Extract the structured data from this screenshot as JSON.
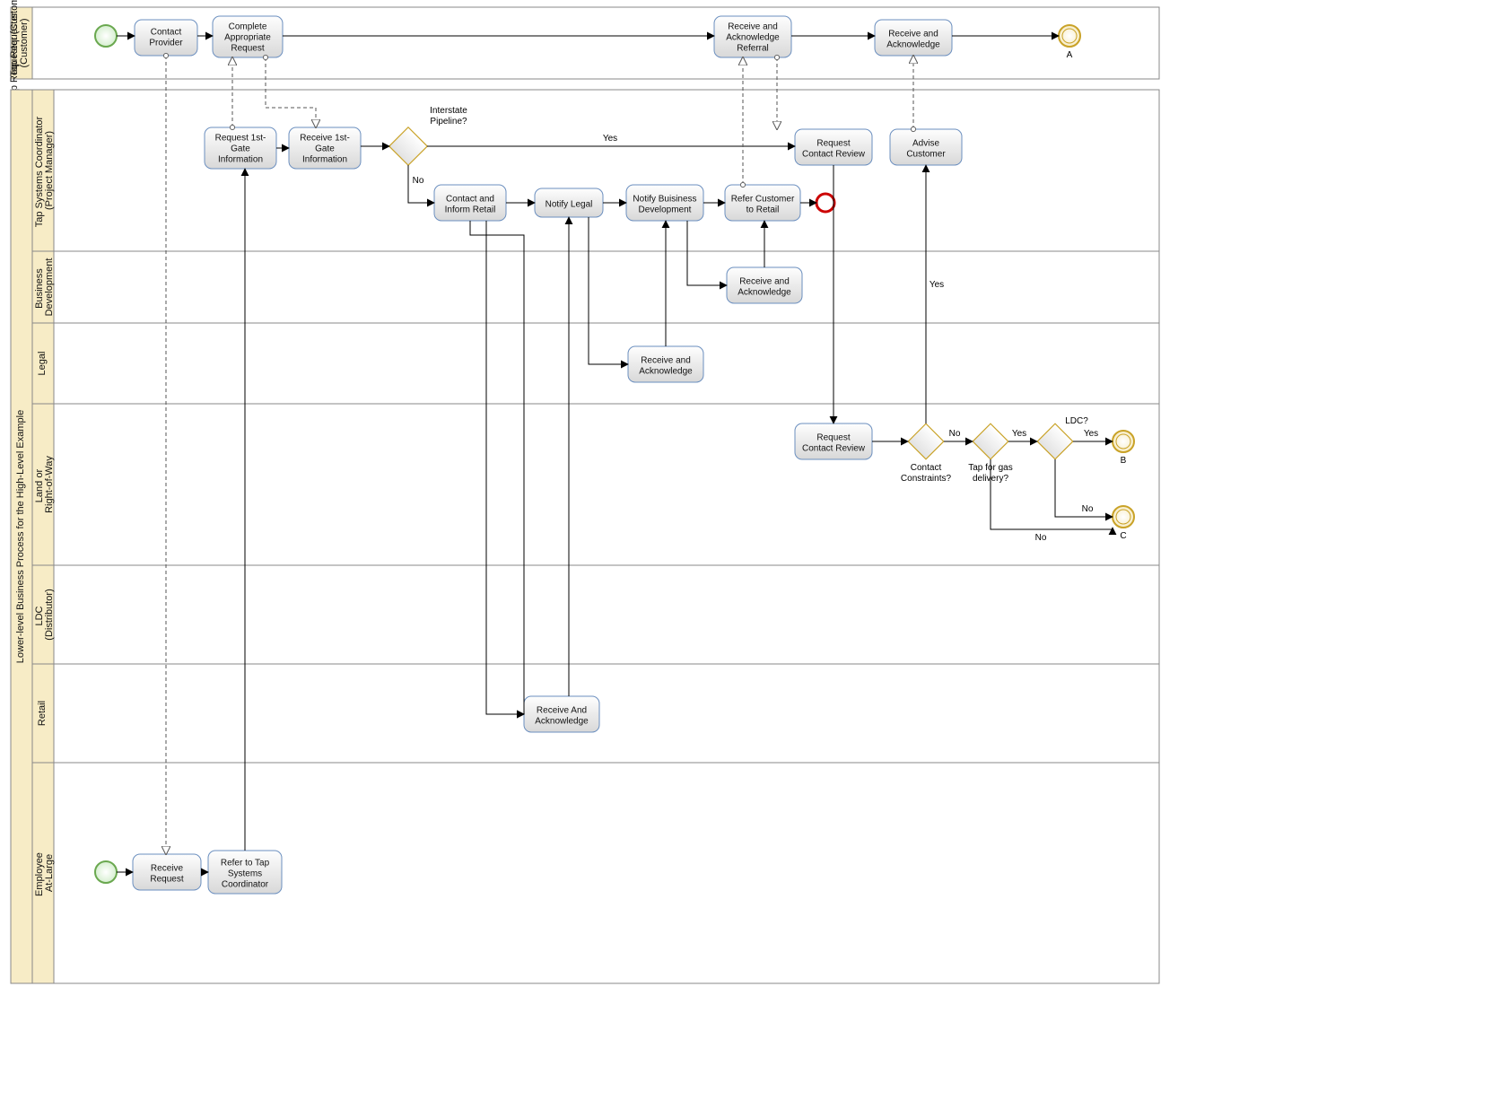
{
  "pool1": {
    "name": "Tap Requester (Customer)",
    "lanes": []
  },
  "pool2": {
    "name": "Lower-level Business Process for the High-Level Example",
    "lanes": [
      "Tap Systems Coordinator (Project Manager)",
      "Business Development",
      "Legal",
      "Land or Right-of-Way",
      "LDC (Distributor)",
      "Retail",
      "Employee At-Large"
    ]
  },
  "tasks": {
    "contactProvider": "Contact Provider",
    "completeRequest": "Complete Appropriate Request",
    "recvAckReferral": "Receive and Acknowledge Referral",
    "recvAck1": "Receive and Acknowledge",
    "request1stGate": "Request 1st-Gate Information",
    "receive1stGate": "Receive 1st-Gate Information",
    "contactInformRetail": "Contact and Inform Retail",
    "notifyLegal": "Notify Legal",
    "notifyBizDev": "Notify Buisiness Development",
    "referCustRetail": "Refer Customer to Retail",
    "requestContactReview": "Request Contact Review",
    "adviseCustomer": "Advise Customer",
    "recvAckBiz": "Receive and Acknowledge",
    "recvAckLegal": "Receive and Acknowledge",
    "requestContactReview2": "Request Contact Review",
    "recvAckRetail": "Receive And Acknowledge",
    "receiveRequest": "Receive Request",
    "referToTSC": "Refer to Tap Systems Coordinator"
  },
  "gateways": {
    "interstate": "Interstate Pipeline?",
    "contactConstraints": "Contact Constraints?",
    "tapForGas": "Tap for gas delivery?",
    "ldc": "LDC?"
  },
  "flowLabels": {
    "yes": "Yes",
    "no": "No"
  },
  "endLabels": {
    "A": "A",
    "B": "B",
    "C": "C"
  }
}
